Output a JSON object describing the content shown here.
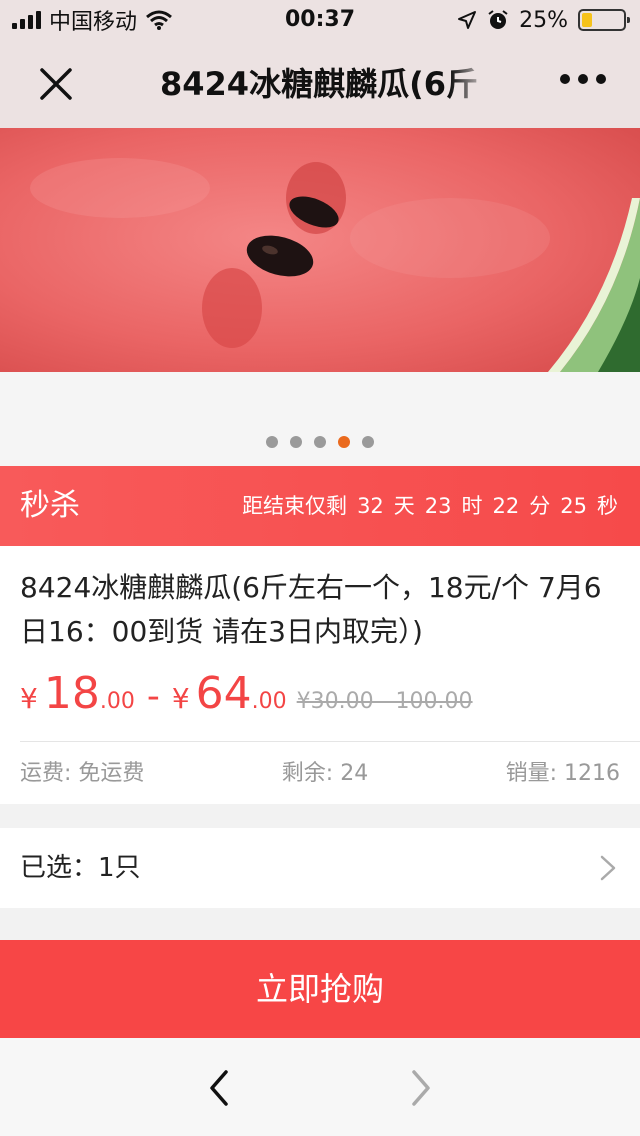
{
  "status_bar": {
    "carrier": "中国移动",
    "time": "00:37",
    "battery": "25%",
    "battery_level": 0.25,
    "signal_icon": "cellular-signal-icon",
    "wifi_icon": "wifi-icon",
    "location_icon": "location-arrow-icon",
    "alarm_icon": "alarm-clock-icon"
  },
  "nav": {
    "title": "8424冰糖麒麟瓜(6斤",
    "close_icon": "close-icon",
    "more_icon": "more-dots-icon"
  },
  "gallery": {
    "dot_count": 5,
    "active_index": 3
  },
  "flash_sale": {
    "label": "秒杀",
    "countdown_prefix": "距结束仅剩",
    "days": "32",
    "days_unit": "天",
    "hours": "23",
    "hours_unit": "时",
    "minutes": "22",
    "minutes_unit": "分",
    "seconds": "25",
    "seconds_unit": "秒"
  },
  "product": {
    "title": "8424冰糖麒麟瓜(6斤左右一个，18元/个 7月6日16：00到货 请在3日内取完）)",
    "currency": "¥",
    "price_low_int": "18",
    "price_low_dec": ".00",
    "price_sep": "-",
    "price_high_int": "64",
    "price_high_dec": ".00",
    "original_price": "¥30.00 - 100.00",
    "shipping": "运费: 免运费",
    "stock": "剩余: 24",
    "sales": "销量: 1216"
  },
  "selection": {
    "label": "已选：1只",
    "chevron_icon": "chevron-right-icon"
  },
  "buy_button": {
    "label": "立即抢购"
  },
  "bottom_nav": {
    "back_icon": "chevron-left-icon",
    "forward_icon": "chevron-right-icon"
  },
  "colors": {
    "accent": "#f74646",
    "dot_active": "#ea6a1e",
    "nav_bg": "#ece2e2"
  }
}
